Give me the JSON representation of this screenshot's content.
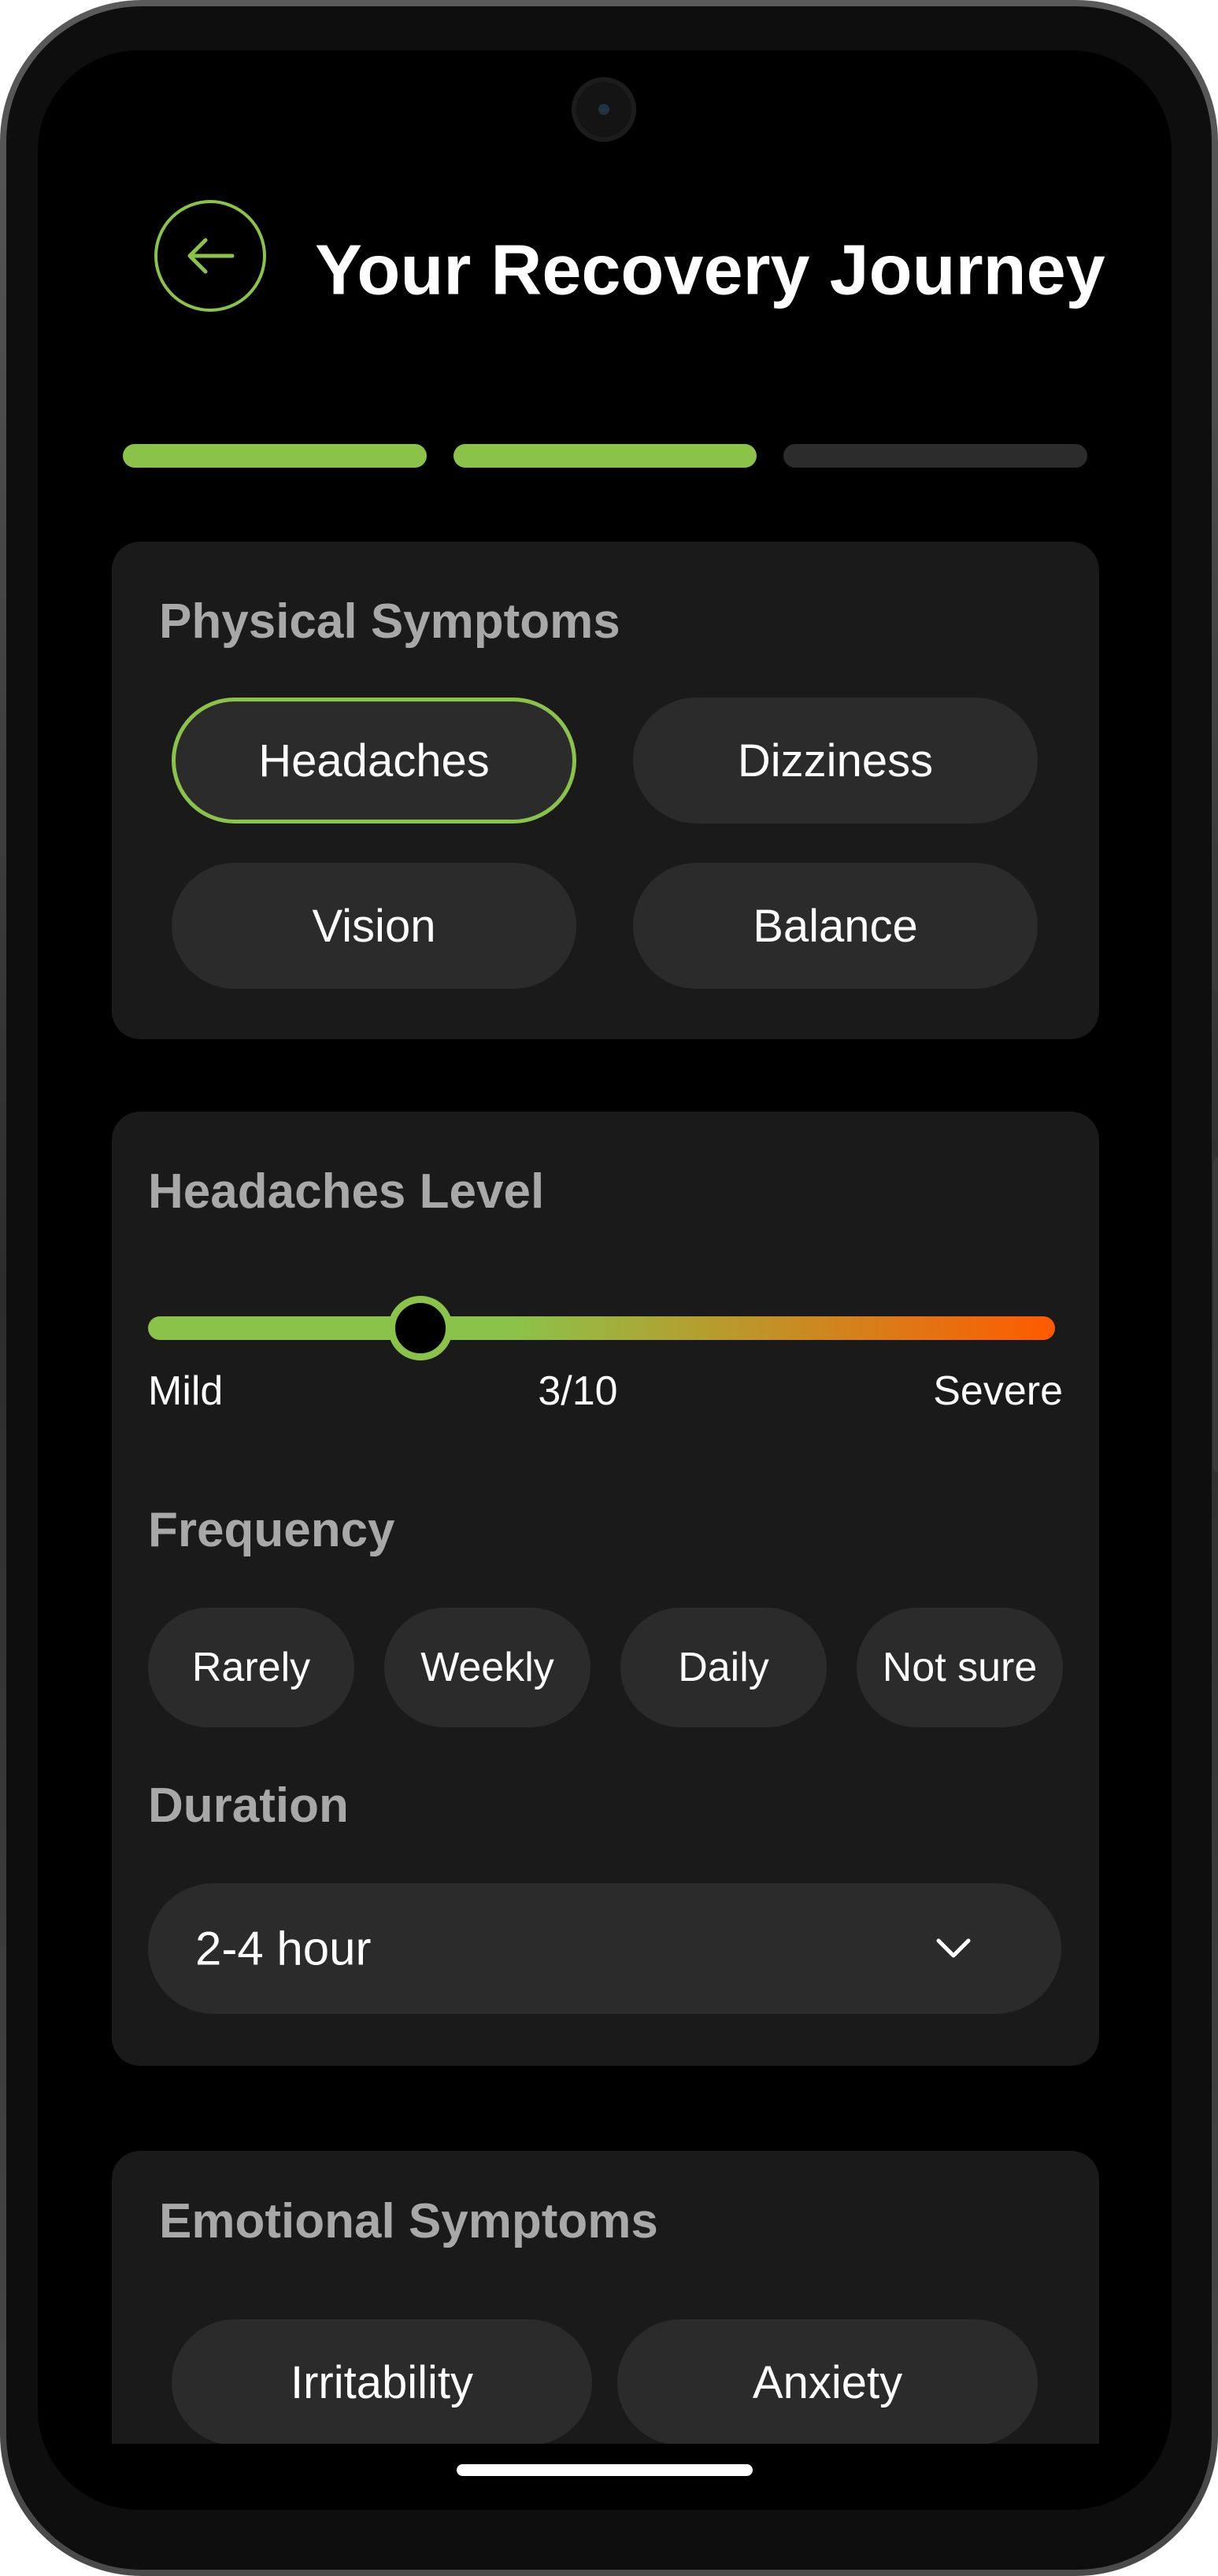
{
  "colors": {
    "accent": "#8bc34a",
    "severe": "#ff5a00",
    "background": "#000000",
    "card": "#1a1a1a",
    "chip": "#2b2b2b",
    "muted_text": "#a8a8a8"
  },
  "header": {
    "back_icon": "arrow-left-icon",
    "title": "Your Recovery Journey"
  },
  "progress": {
    "total_steps": 3,
    "completed_steps": 2
  },
  "physical_symptoms": {
    "title": "Physical Symptoms",
    "options": [
      {
        "label": "Headaches",
        "selected": true
      },
      {
        "label": "Dizziness",
        "selected": false
      },
      {
        "label": "Vision",
        "selected": false
      },
      {
        "label": "Balance",
        "selected": false
      }
    ]
  },
  "details": {
    "level_title": "Headaches Level",
    "level": {
      "value": 3,
      "max": 10,
      "display": "3/10",
      "min_label": "Mild",
      "max_label": "Severe"
    },
    "frequency_title": "Frequency",
    "frequency_options": [
      "Rarely",
      "Weekly",
      "Daily",
      "Not sure"
    ],
    "duration_title": "Duration",
    "duration": {
      "value": "2-4 hour",
      "icon": "chevron-down-icon"
    }
  },
  "emotional_symptoms": {
    "title": "Emotional Symptoms",
    "options": [
      {
        "label": "Irritability",
        "selected": false
      },
      {
        "label": "Anxiety",
        "selected": false
      }
    ]
  }
}
